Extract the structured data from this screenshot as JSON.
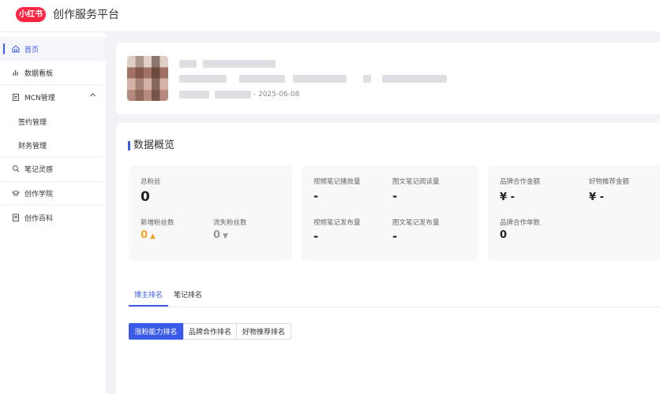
{
  "header": {
    "logo_text": "小红书",
    "app_title": "创作服务平台"
  },
  "sidebar": {
    "items": [
      {
        "label": "首页",
        "icon": "home-icon"
      },
      {
        "label": "数据看板",
        "icon": "bar-chart-icon"
      },
      {
        "label": "MCN管理",
        "icon": "clipboard-icon"
      },
      {
        "label": "签约管理"
      },
      {
        "label": "财务管理"
      },
      {
        "label": "笔记灵感",
        "icon": "lightbulb-search-icon"
      },
      {
        "label": "创作学院",
        "icon": "graduation-icon"
      },
      {
        "label": "创作百科",
        "icon": "book-icon"
      }
    ]
  },
  "profile": {
    "date": "- 2025-06-08"
  },
  "overview": {
    "title": "数据概览",
    "fans": {
      "total_label": "总粉丝",
      "total_value": "0",
      "new_label": "新增粉丝数",
      "new_value": "0",
      "lost_label": "流失粉丝数",
      "lost_value": "0"
    },
    "notes": {
      "video_play_label": "视频笔记播放量",
      "video_play_value": "-",
      "image_read_label": "图文笔记阅读量",
      "image_read_value": "-",
      "video_pub_label": "视频笔记发布量",
      "video_pub_value": "-",
      "image_pub_label": "图文笔记发布量",
      "image_pub_value": "-"
    },
    "brand": {
      "amount_label": "品牌合作金额",
      "amount_value": "¥ -",
      "goods_label": "好物推荐金额",
      "goods_value": "¥ -",
      "count_label": "品牌合作单数",
      "count_value": "0"
    }
  },
  "tabs": [
    {
      "label": "博主排名"
    },
    {
      "label": "笔记排名"
    }
  ],
  "segments": [
    {
      "label": "涨粉能力排名"
    },
    {
      "label": "品牌合作排名"
    },
    {
      "label": "好物推荐排名"
    }
  ],
  "colors": {
    "accent": "#3a5be8",
    "brand": "#ff2442",
    "up_arrow": "#f5a623"
  }
}
